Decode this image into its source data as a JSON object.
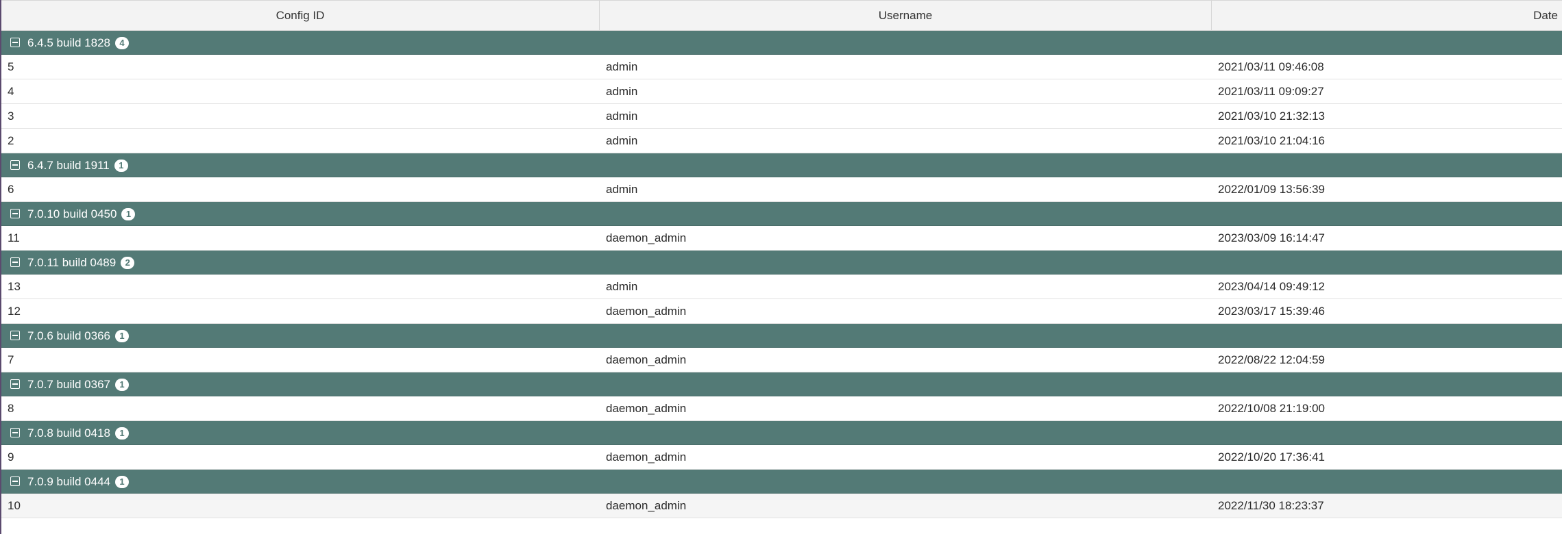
{
  "columns": {
    "config_id": "Config ID",
    "username": "Username",
    "date": "Date"
  },
  "groups": [
    {
      "label": "6.4.5 build 1828",
      "count": "4",
      "rows": [
        {
          "config_id": "5",
          "username": "admin",
          "date": "2021/03/11 09:46:08"
        },
        {
          "config_id": "4",
          "username": "admin",
          "date": "2021/03/11 09:09:27"
        },
        {
          "config_id": "3",
          "username": "admin",
          "date": "2021/03/10 21:32:13"
        },
        {
          "config_id": "2",
          "username": "admin",
          "date": "2021/03/10 21:04:16"
        }
      ]
    },
    {
      "label": "6.4.7 build 1911",
      "count": "1",
      "rows": [
        {
          "config_id": "6",
          "username": "admin",
          "date": "2022/01/09 13:56:39"
        }
      ]
    },
    {
      "label": "7.0.10 build 0450",
      "count": "1",
      "rows": [
        {
          "config_id": "11",
          "username": "daemon_admin",
          "date": "2023/03/09 16:14:47"
        }
      ]
    },
    {
      "label": "7.0.11 build 0489",
      "count": "2",
      "rows": [
        {
          "config_id": "13",
          "username": "admin",
          "date": "2023/04/14 09:49:12"
        },
        {
          "config_id": "12",
          "username": "daemon_admin",
          "date": "2023/03/17 15:39:46"
        }
      ]
    },
    {
      "label": "7.0.6 build 0366",
      "count": "1",
      "rows": [
        {
          "config_id": "7",
          "username": "daemon_admin",
          "date": "2022/08/22 12:04:59"
        }
      ]
    },
    {
      "label": "7.0.7 build 0367",
      "count": "1",
      "rows": [
        {
          "config_id": "8",
          "username": "daemon_admin",
          "date": "2022/10/08 21:19:00"
        }
      ]
    },
    {
      "label": "7.0.8 build 0418",
      "count": "1",
      "rows": [
        {
          "config_id": "9",
          "username": "daemon_admin",
          "date": "2022/10/20 17:36:41"
        }
      ]
    },
    {
      "label": "7.0.9 build 0444",
      "count": "1",
      "rows": [
        {
          "config_id": "10",
          "username": "daemon_admin",
          "date": "2022/11/30 18:23:37"
        }
      ]
    }
  ],
  "colors": {
    "group_header": "#537a76",
    "header_bg": "#f3f3f3"
  }
}
